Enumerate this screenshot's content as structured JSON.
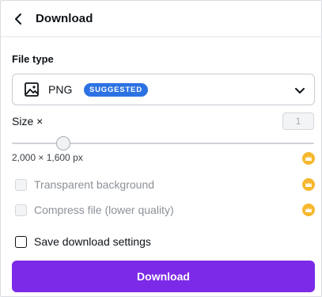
{
  "header": {
    "back_icon": "chevron-left-icon",
    "title": "Download"
  },
  "file_type": {
    "label": "File type",
    "selected": "PNG",
    "badge": "SUGGESTED",
    "icon": "image-icon"
  },
  "size": {
    "label": "Size ×",
    "value": "1",
    "slider_fraction": 0.17,
    "dimensions": "2,000 × 1,600 px"
  },
  "options": {
    "transparent": "Transparent background",
    "compress": "Compress file (lower quality)",
    "save_settings": "Save download settings"
  },
  "download_button": "Download",
  "colors": {
    "accent": "#7d2ae8",
    "badge": "#2d72e3",
    "crown": "#f5b82e"
  }
}
